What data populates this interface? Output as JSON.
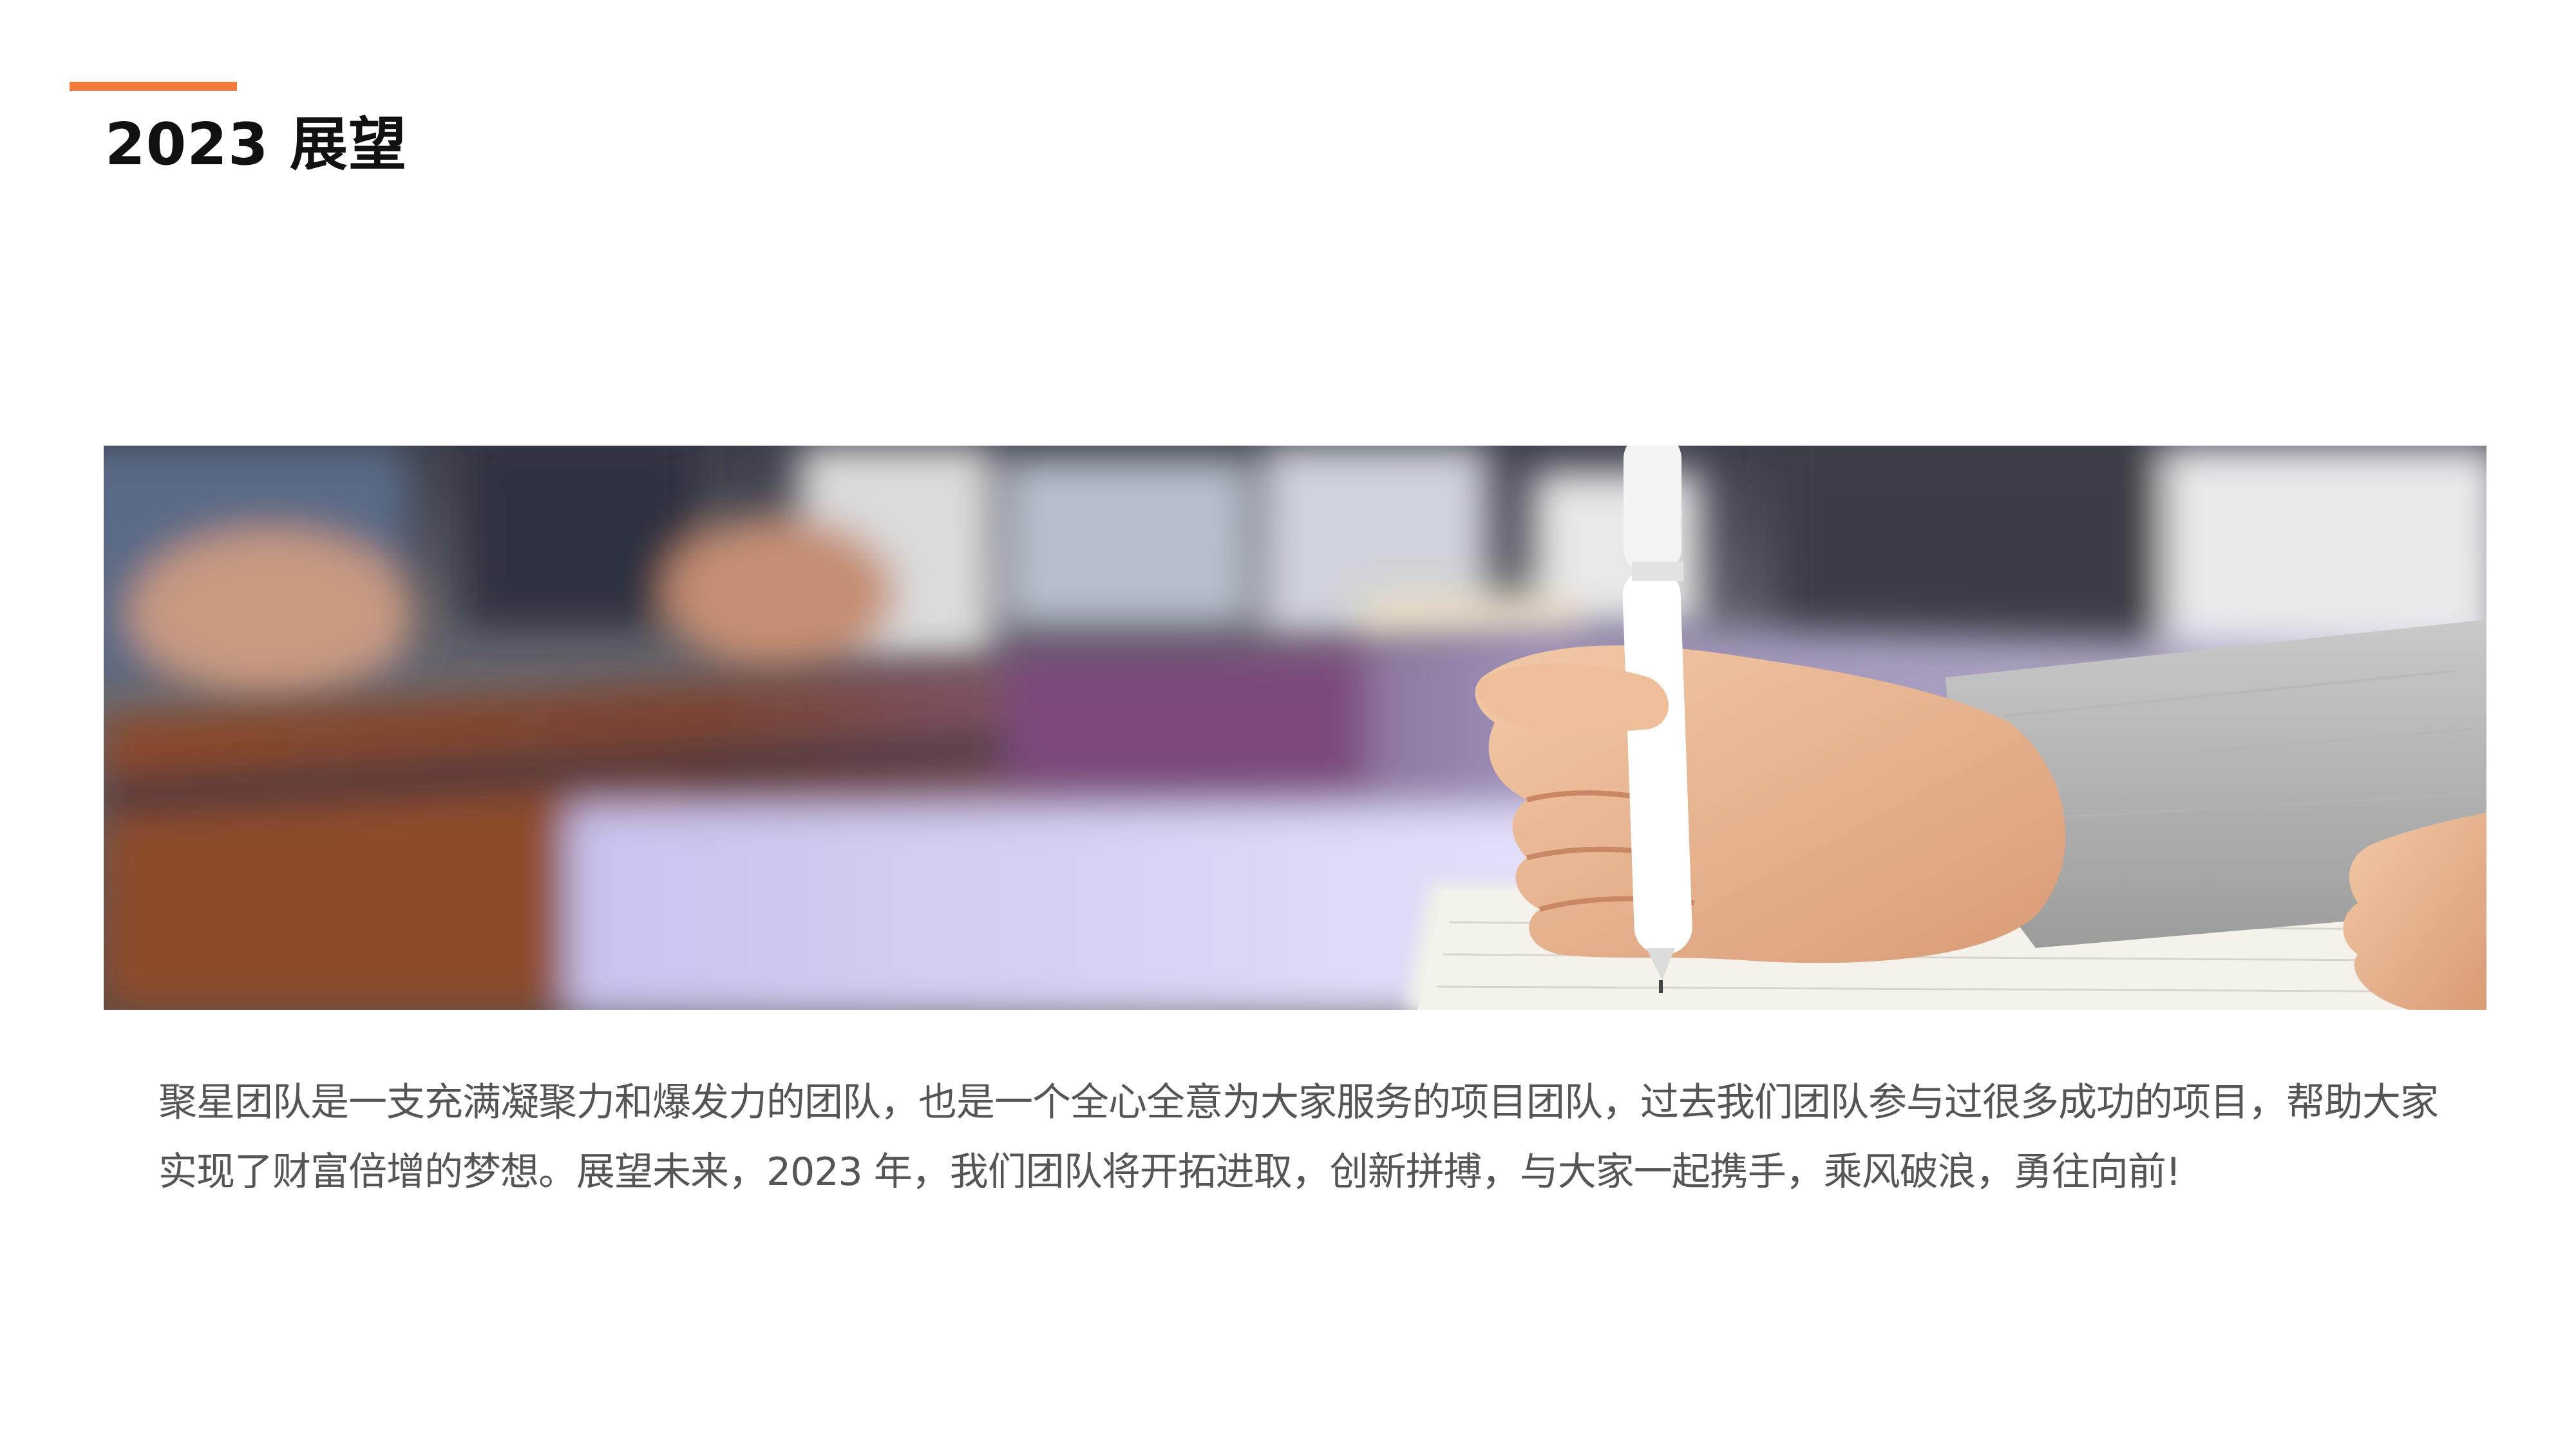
{
  "slide": {
    "title": "2023 展望",
    "accent_color": "#f47a3a",
    "body": "聚星团队是一支充满凝聚力和爆发力的团队，也是一个全心全意为大家服务的项目团队，过去我们团队参与过很多成功的项目，帮助大家实现了财富倍增的梦想。展望未来，2023 年，我们团队将开拓进取，创新拼搏，与大家一起携手，乘风破浪，勇往向前!"
  },
  "image": {
    "subject": "hand-writing-with-pen-photo"
  }
}
